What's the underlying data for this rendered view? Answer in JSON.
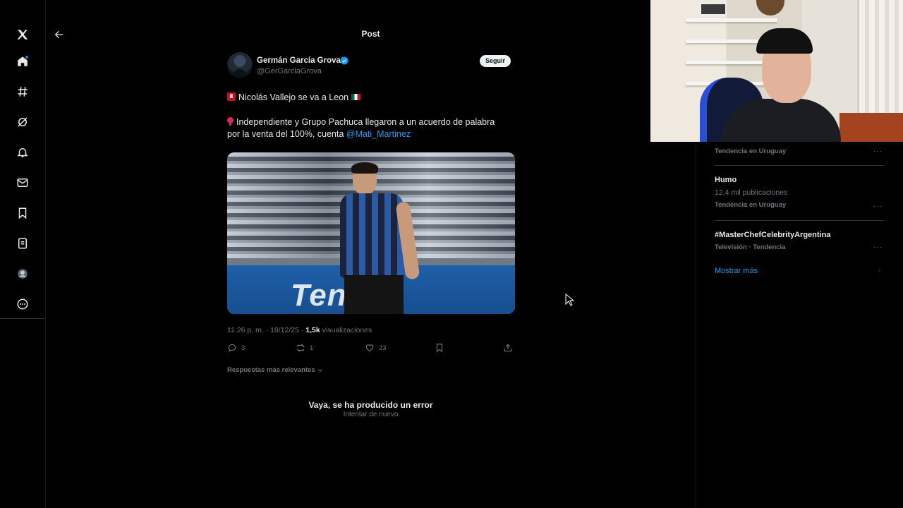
{
  "app": {
    "logo_icon": "x-logo-icon"
  },
  "nav": {
    "items": [
      {
        "name": "home",
        "icon": "home-icon"
      },
      {
        "name": "explore",
        "icon": "hashtag-icon"
      },
      {
        "name": "grok",
        "icon": "grok-icon"
      },
      {
        "name": "notifications",
        "icon": "bell-icon"
      },
      {
        "name": "messages",
        "icon": "envelope-icon"
      },
      {
        "name": "bookmarks",
        "icon": "bookmark-icon"
      },
      {
        "name": "lists",
        "icon": "list-icon"
      },
      {
        "name": "profile",
        "icon": "avatar-icon"
      },
      {
        "name": "more",
        "icon": "more-circle-icon"
      }
    ]
  },
  "header": {
    "title": "Post"
  },
  "post": {
    "author_name": "Germán García Grova",
    "author_handle": "@GerGarciaGrova",
    "follow_label": "Seguir",
    "line1": "Nicolás Vallejo se va a Leon",
    "line2": "Independiente y Grupo Pachuca llegaron a un acuerdo de palabra por la venta del 100%, cuenta ",
    "mention": "@Mati_Martinez",
    "media_board_text": "Teneld",
    "timestamp": "11:26 p. m. · 18/12/25 · ",
    "views_count": "1,5k",
    "views_label": " visualizaciones",
    "replies": "3",
    "reposts": "1",
    "likes": "23",
    "sort_label": "Respuestas más relevantes"
  },
  "error": {
    "title": "Vaya, se ha producido un error",
    "retry": "Intentar de nuevo"
  },
  "trends": [
    {
      "name": "",
      "sub": "",
      "context": "Tendencia en Uruguay"
    },
    {
      "name": "Humo",
      "sub": "12,4 mil publicaciones",
      "context": "Tendencia en Uruguay"
    },
    {
      "name": "#MasterChefCelebrityArgentina",
      "sub": "",
      "context": "Televisión · Tendencia"
    }
  ],
  "show_more": "Mostrar más",
  "colors": {
    "accent": "#1d9bf0",
    "background": "#000000",
    "muted": "#71767b",
    "text": "#e7e9ea"
  }
}
